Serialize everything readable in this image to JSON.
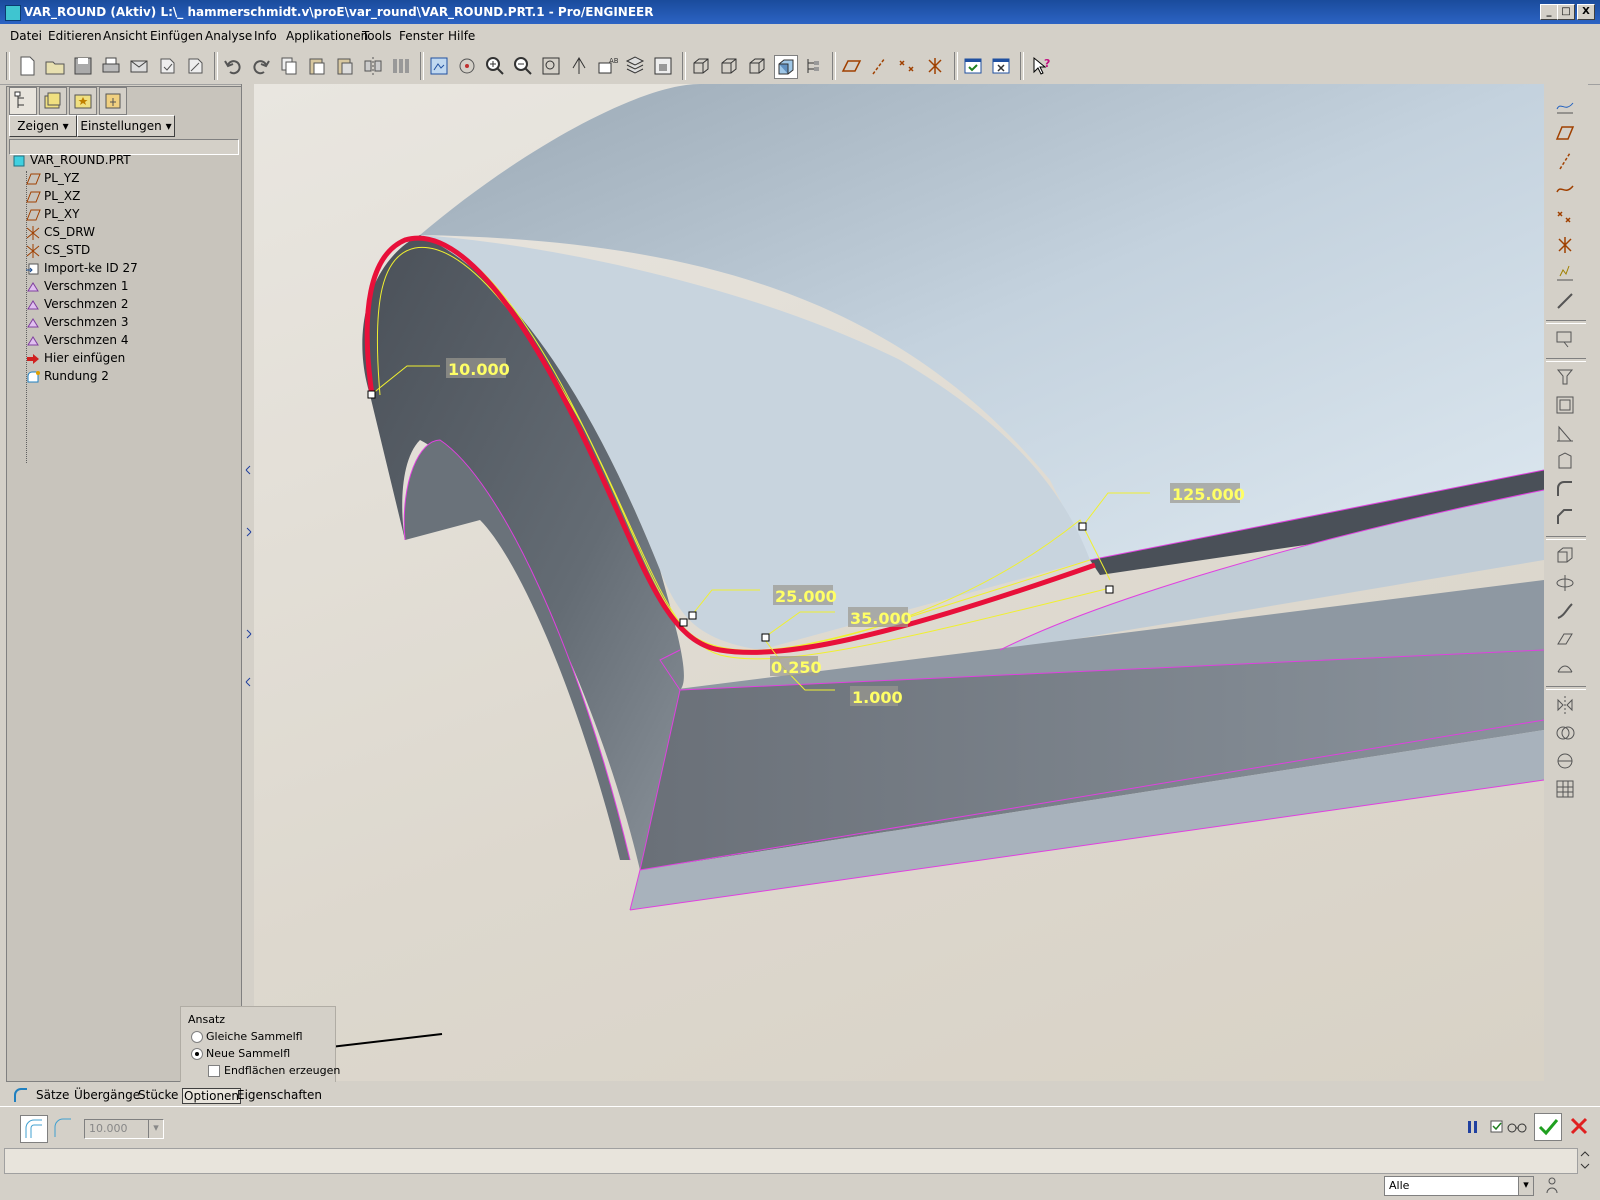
{
  "window": {
    "title": "VAR_ROUND (Aktiv) L:\\_ hammerschmidt.v\\proE\\var_round\\VAR_ROUND.PRT.1 - Pro/ENGINEER",
    "controls": [
      "_",
      "□",
      "X"
    ]
  },
  "menu": [
    "Datei",
    "Editieren",
    "Ansicht",
    "Einfügen",
    "Analyse",
    "Info",
    "Applikationen",
    "Tools",
    "Fenster",
    "Hilfe"
  ],
  "panel": {
    "show_button": "Zeigen",
    "settings_button": "Einstellungen",
    "tree": [
      {
        "label": "VAR_ROUND.PRT",
        "icon": "part-icon"
      },
      {
        "label": "PL_YZ",
        "icon": "datum-plane-icon"
      },
      {
        "label": "PL_XZ",
        "icon": "datum-plane-icon"
      },
      {
        "label": "PL_XY",
        "icon": "datum-plane-icon"
      },
      {
        "label": "CS_DRW",
        "icon": "coordinate-system-icon"
      },
      {
        "label": "CS_STD",
        "icon": "coordinate-system-icon"
      },
      {
        "label": "Import-ke ID 27",
        "icon": "import-feature-icon"
      },
      {
        "label": "Verschmzen 1",
        "icon": "merge-feature-icon"
      },
      {
        "label": "Verschmzen 2",
        "icon": "merge-feature-icon"
      },
      {
        "label": "Verschmzen 3",
        "icon": "merge-feature-icon"
      },
      {
        "label": "Verschmzen 4",
        "icon": "merge-feature-icon"
      },
      {
        "label": "Hier einfügen",
        "icon": "insert-here-arrow-icon"
      },
      {
        "label": "Rundung 2",
        "icon": "round-feature-icon"
      }
    ]
  },
  "viewport": {
    "dimensions": [
      "10.000",
      "25.000",
      "35.000",
      "0.250",
      "1.000",
      "125.000"
    ]
  },
  "options_panel": {
    "title": "Ansatz",
    "radio_same": "Gleiche Sammelfl",
    "radio_new": "Neue Sammelfl",
    "checkbox_end": "Endflächen erzeugen",
    "selected": "Neue Sammelfl"
  },
  "dashboard_tabs": [
    "Sätze",
    "Übergänge",
    "Stücke",
    "Optionen",
    "Eigenschaften"
  ],
  "dashboard": {
    "radius_value": "10.000"
  },
  "status": {
    "filter_value": "Alle"
  },
  "colors": {
    "title_bar": "#1f56b0",
    "selected_edge": "#e8103a",
    "dimension_text": "#ffff66",
    "edge_highlight": "#e040e0"
  }
}
